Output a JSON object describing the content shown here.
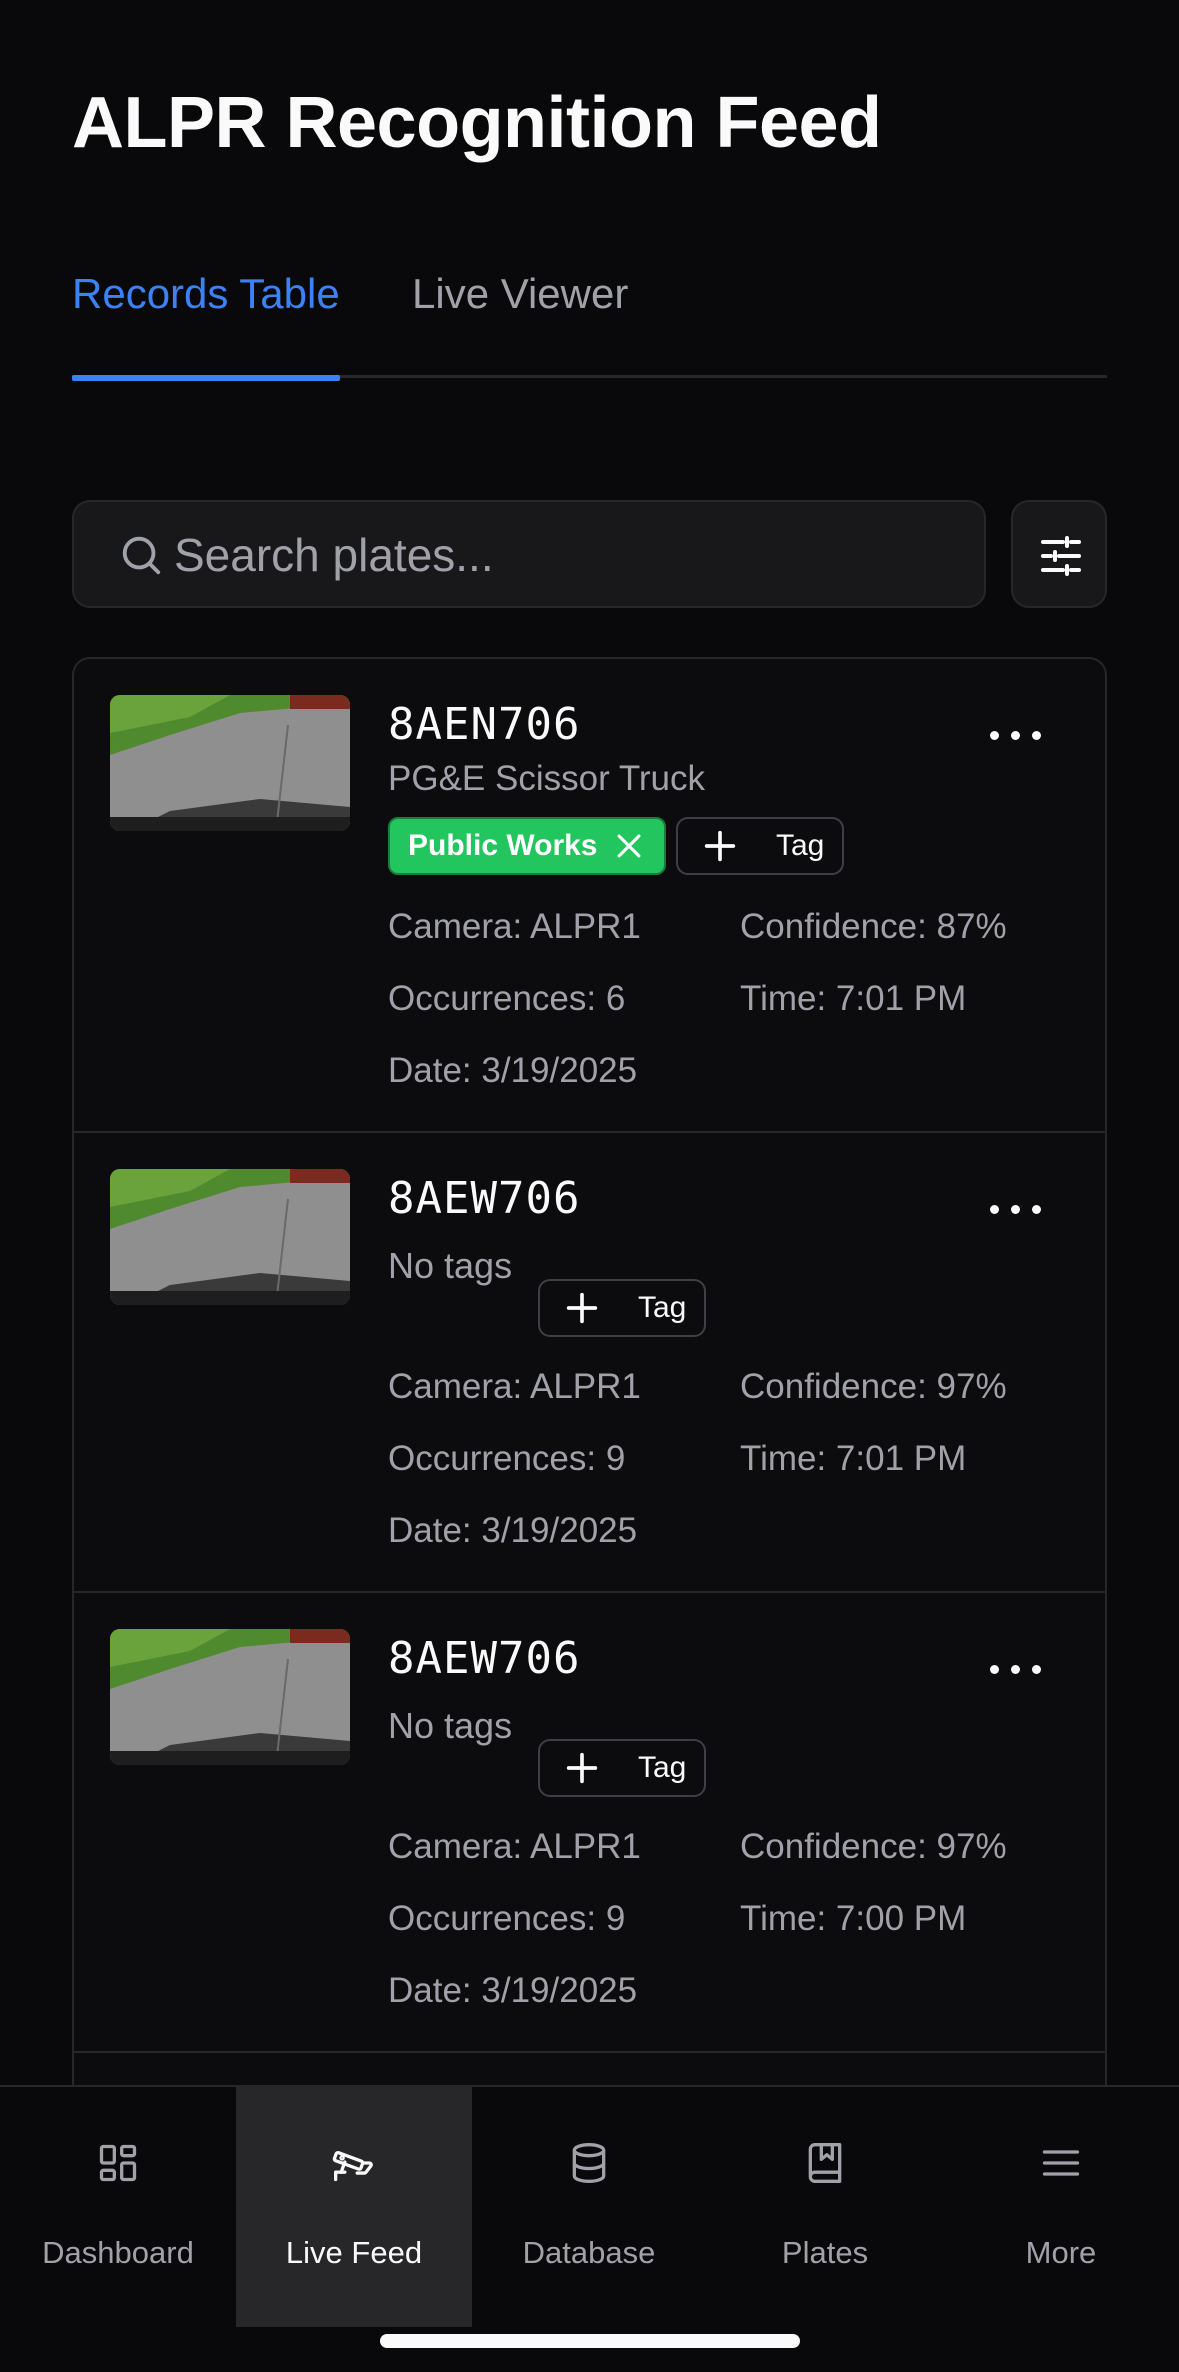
{
  "page": {
    "title": "ALPR Recognition Feed"
  },
  "tabs": [
    {
      "label": "Records Table",
      "active": true
    },
    {
      "label": "Live Viewer",
      "active": false
    }
  ],
  "search": {
    "placeholder": "Search plates...",
    "value": ""
  },
  "icons": {
    "search": "search-icon",
    "filter": "sliders-icon",
    "more": "more-horizontal-icon",
    "add": "plus-icon",
    "remove": "x-icon"
  },
  "records": [
    {
      "plate": "8AEN706",
      "description": "PG&E Scissor Truck",
      "tags": [
        "Public Works"
      ],
      "no_tags_label": "",
      "add_tag_label": "Tag",
      "camera": "Camera: ALPR1",
      "confidence": "Confidence: 87%",
      "occurrences": "Occurrences: 6",
      "time": "Time: 7:01 PM",
      "date": "Date: 3/19/2025"
    },
    {
      "plate": "8AEW706",
      "description": "",
      "tags": [],
      "no_tags_label": "No tags",
      "add_tag_label": "Tag",
      "camera": "Camera: ALPR1",
      "confidence": "Confidence: 97%",
      "occurrences": "Occurrences: 9",
      "time": "Time: 7:01 PM",
      "date": "Date: 3/19/2025"
    },
    {
      "plate": "8AEW706",
      "description": "",
      "tags": [],
      "no_tags_label": "No tags",
      "add_tag_label": "Tag",
      "camera": "Camera: ALPR1",
      "confidence": "Confidence: 97%",
      "occurrences": "Occurrences: 9",
      "time": "Time: 7:00 PM",
      "date": "Date: 3/19/2025"
    }
  ],
  "colors": {
    "accent": "#3b82f6",
    "tag_green": "#22c55e",
    "background": "#09090b",
    "muted_text": "#a1a1aa"
  },
  "bottom_nav": [
    {
      "label": "Dashboard",
      "icon": "layout-grid-icon",
      "active": false
    },
    {
      "label": "Live Feed",
      "icon": "cctv-camera-icon",
      "active": true
    },
    {
      "label": "Database",
      "icon": "database-icon",
      "active": false
    },
    {
      "label": "Plates",
      "icon": "book-marked-icon",
      "active": false
    },
    {
      "label": "More",
      "icon": "menu-icon",
      "active": false
    }
  ]
}
